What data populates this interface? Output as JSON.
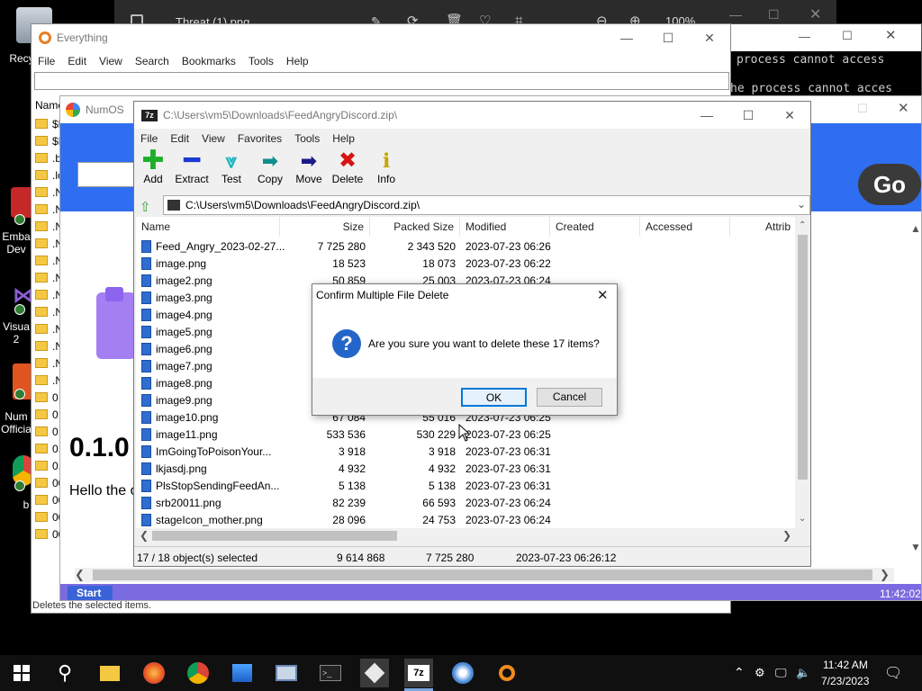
{
  "desktop": {
    "icons": [
      "Recy",
      "Emba Dev",
      "Visua 2",
      "Num Officia",
      "b"
    ]
  },
  "photo_viewer": {
    "title": "Threat (1).png",
    "zoom": "100%"
  },
  "console": {
    "lines": [
      "process cannot access",
      "he process cannot acces"
    ]
  },
  "everything": {
    "title": "Everything",
    "menu": [
      "File",
      "Edit",
      "View",
      "Search",
      "Bookmarks",
      "Tools",
      "Help"
    ],
    "search_value": "",
    "column_name": "Name",
    "rows": [
      "$F",
      "$F",
      ".b",
      ".lo",
      ".N",
      ".N",
      ".N",
      ".N",
      ".N",
      ".N",
      ".N",
      ".N",
      ".N",
      ".N",
      ".N",
      ".N",
      "0",
      "0",
      "0",
      "0.",
      "0.",
      "00",
      "00",
      "00",
      "00"
    ],
    "status": "Deletes the selected items."
  },
  "numos": {
    "title": "NumOS",
    "go_label": "Go",
    "version": "0.1.0",
    "hello": "Hello the o",
    "start_label": "Start",
    "clock": "11:42:02 A"
  },
  "sevenzip": {
    "title": "C:\\Users\\vm5\\Downloads\\FeedAngryDiscord.zip\\",
    "menu": [
      "File",
      "Edit",
      "View",
      "Favorites",
      "Tools",
      "Help"
    ],
    "toolbar": [
      "Add",
      "Extract",
      "Test",
      "Copy",
      "Move",
      "Delete",
      "Info"
    ],
    "address": "C:\\Users\\vm5\\Downloads\\FeedAngryDiscord.zip\\",
    "columns": [
      "Name",
      "Size",
      "Packed Size",
      "Modified",
      "Created",
      "Accessed",
      "Attrib"
    ],
    "files": [
      {
        "name": "Feed_Angry_2023-02-27...",
        "size": "7 725 280",
        "packed": "2 343 520",
        "modified": "2023-07-23 06:26",
        "folder": true
      },
      {
        "name": "image.png",
        "size": "18 523",
        "packed": "18 073",
        "modified": "2023-07-23 06:22"
      },
      {
        "name": "image2.png",
        "size": "50 859",
        "packed": "25 003",
        "modified": "2023-07-23 06:24"
      },
      {
        "name": "image3.png",
        "size": "",
        "packed": "",
        "modified": ""
      },
      {
        "name": "image4.png",
        "size": "",
        "packed": "",
        "modified": ""
      },
      {
        "name": "image5.png",
        "size": "",
        "packed": "",
        "modified": ""
      },
      {
        "name": "image6.png",
        "size": "",
        "packed": "",
        "modified": ""
      },
      {
        "name": "image7.png",
        "size": "",
        "packed": "",
        "modified": ""
      },
      {
        "name": "image8.png",
        "size": "",
        "packed": "",
        "modified": ""
      },
      {
        "name": "image9.png",
        "size": "",
        "packed": "",
        "modified": ""
      },
      {
        "name": "image10.png",
        "size": "67 084",
        "packed": "55 016",
        "modified": "2023-07-23 06:25"
      },
      {
        "name": "image11.png",
        "size": "533 536",
        "packed": "530 229",
        "modified": "2023-07-23 06:25"
      },
      {
        "name": "ImGoingToPoisonYour...",
        "size": "3 918",
        "packed": "3 918",
        "modified": "2023-07-23 06:31"
      },
      {
        "name": "lkjasdj.png",
        "size": "4 932",
        "packed": "4 932",
        "modified": "2023-07-23 06:31"
      },
      {
        "name": "PlsStopSendingFeedAn...",
        "size": "5 138",
        "packed": "5 138",
        "modified": "2023-07-23 06:31"
      },
      {
        "name": "srb20011.png",
        "size": "82 239",
        "packed": "66 593",
        "modified": "2023-07-23 06:24"
      },
      {
        "name": "stageIcon_mother.png",
        "size": "28 096",
        "packed": "24 753",
        "modified": "2023-07-23 06:24"
      }
    ],
    "status": {
      "selected": "17 / 18 object(s) selected",
      "size": "9 614 868",
      "packed": "7 725 280",
      "modified": "2023-07-23 06:26:12"
    }
  },
  "dialog": {
    "title": "Confirm Multiple File Delete",
    "message": "Are you sure you want to delete these 17 items?",
    "ok_label": "OK",
    "cancel_label": "Cancel"
  },
  "taskbar": {
    "time": "11:42 AM",
    "date": "7/23/2023"
  }
}
